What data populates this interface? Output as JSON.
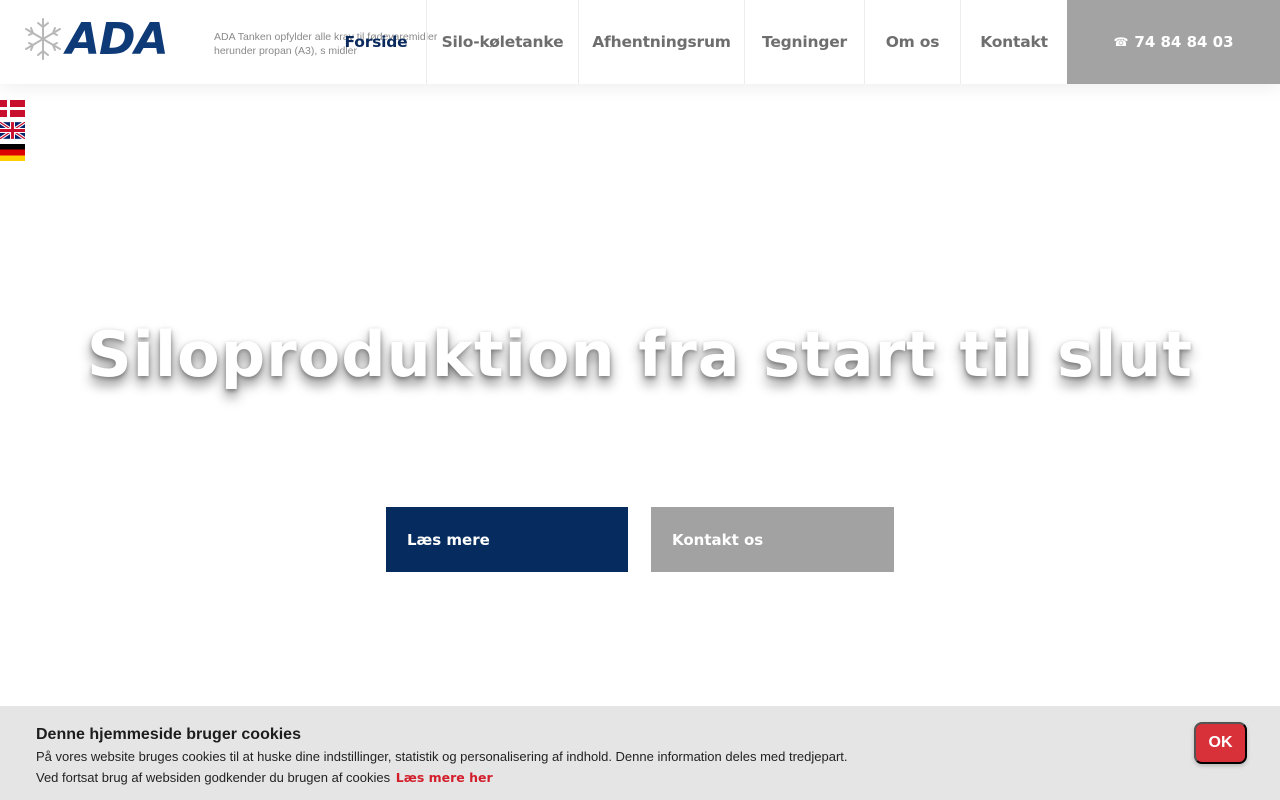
{
  "header": {
    "logo_text": "ADA",
    "logo_icon": "snowflake-drop-icon",
    "tagline_line1": "ADA Tanken opfylder alle krav til fødevaremidler",
    "tagline_line2": "herunder propan (A3), s                midler",
    "nav": [
      {
        "label": "Forside",
        "active": true
      },
      {
        "label": "Silo-køletanke",
        "active": false
      },
      {
        "label": "Afhentningsrum",
        "active": false
      },
      {
        "label": "Tegninger",
        "active": false
      },
      {
        "label": "Om os",
        "active": false
      },
      {
        "label": "Kontakt",
        "active": false
      }
    ],
    "phone_icon": "☎",
    "phone": "74 84 84 03"
  },
  "flags": [
    {
      "name": "danish-flag-icon"
    },
    {
      "name": "english-flag-icon"
    },
    {
      "name": "german-flag-icon"
    }
  ],
  "hero": {
    "title": "Siloproduktion fra start til slut",
    "primary_button": "Læs mere",
    "secondary_button": "Kontakt os"
  },
  "cookie": {
    "title": "Denne hjemmeside bruger cookies",
    "text1": "På vores website bruges cookies til at huske dine indstillinger, statistik og personalisering af indhold. Denne information deles med tredjepart.",
    "text2": "Ved fortsat brug af websiden godkender du brugen af cookies",
    "link": "Læs mere her",
    "ok": "OK"
  },
  "colors": {
    "brand_navy": "#062c5f",
    "gray_button": "#a2a2a2",
    "cookie_ok": "#d9313a"
  }
}
